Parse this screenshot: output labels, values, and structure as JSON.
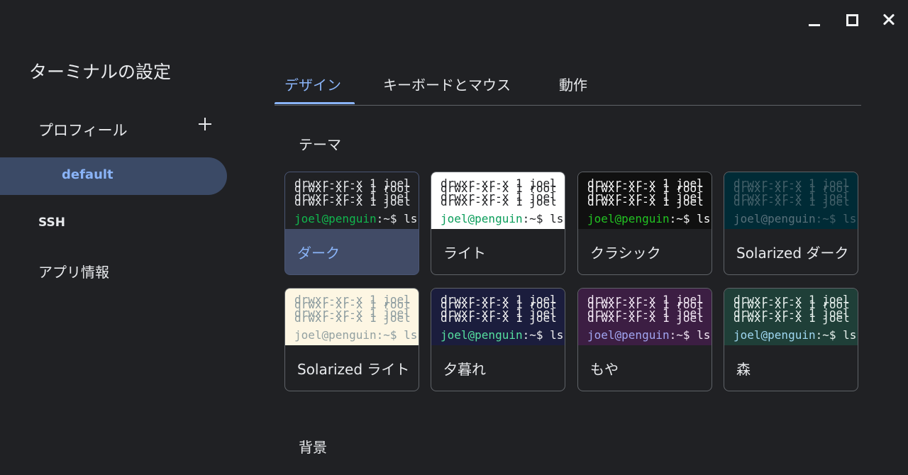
{
  "window": {
    "controls": [
      "minimize-icon",
      "maximize-icon",
      "close-icon"
    ]
  },
  "sidebar": {
    "title": "ターミナルの設定",
    "profiles_label": "プロフィール",
    "add_icon": "plus-icon",
    "profiles": [
      {
        "label": "default",
        "selected": true
      }
    ],
    "items": [
      {
        "label": "SSH"
      },
      {
        "label": "アプリ情報"
      }
    ]
  },
  "tabs": [
    {
      "label": "デザイン",
      "active": true
    },
    {
      "label": "キーボードとマウス",
      "active": false
    },
    {
      "label": "動作",
      "active": false
    }
  ],
  "theme_section": {
    "heading": "テーマ",
    "preview_lines": [
      "drwxr-xr-x 1 joel",
      "drwxr-xr-x 1 root",
      "drwxr-xr-x 1 joel",
      "drwxr-xr-x 1 joel"
    ],
    "prompt_user": "joel@penguin",
    "prompt_rest": ":~$ ls",
    "themes": [
      {
        "label": "ダーク",
        "selected": true,
        "bg": "#202124",
        "fg": "#e8eaed",
        "prompt": "#11b74e"
      },
      {
        "label": "ライト",
        "selected": false,
        "bg": "#ffffff",
        "fg": "#202124",
        "prompt": "#0a9d5a"
      },
      {
        "label": "クラシック",
        "selected": false,
        "bg": "#101010",
        "fg": "#f8f8f8",
        "prompt": "#22c322"
      },
      {
        "label": "Solarized ダーク",
        "selected": false,
        "bg": "#002b36",
        "fg": "#45616a",
        "prompt": "#58707a"
      },
      {
        "label": "Solarized ライト",
        "selected": false,
        "bg": "#fdf6e3",
        "fg": "#8a9a9e",
        "prompt": "#93a1a1"
      },
      {
        "label": "夕暮れ",
        "selected": false,
        "bg": "#1b1d3d",
        "fg": "#f2f2f2",
        "prompt": "#56e0a0"
      },
      {
        "label": "もや",
        "selected": false,
        "bg": "#3c1e43",
        "fg": "#f4e9f6",
        "prompt": "#a2a6f2"
      },
      {
        "label": "森",
        "selected": false,
        "bg": "#1f3f38",
        "fg": "#e8f1ee",
        "prompt": "#9fd8f2"
      }
    ]
  },
  "background_section": {
    "heading": "背景"
  },
  "colors": {
    "accent": "#8ab4f8",
    "selected_bg": "#414b66",
    "window_bg": "#202124"
  }
}
